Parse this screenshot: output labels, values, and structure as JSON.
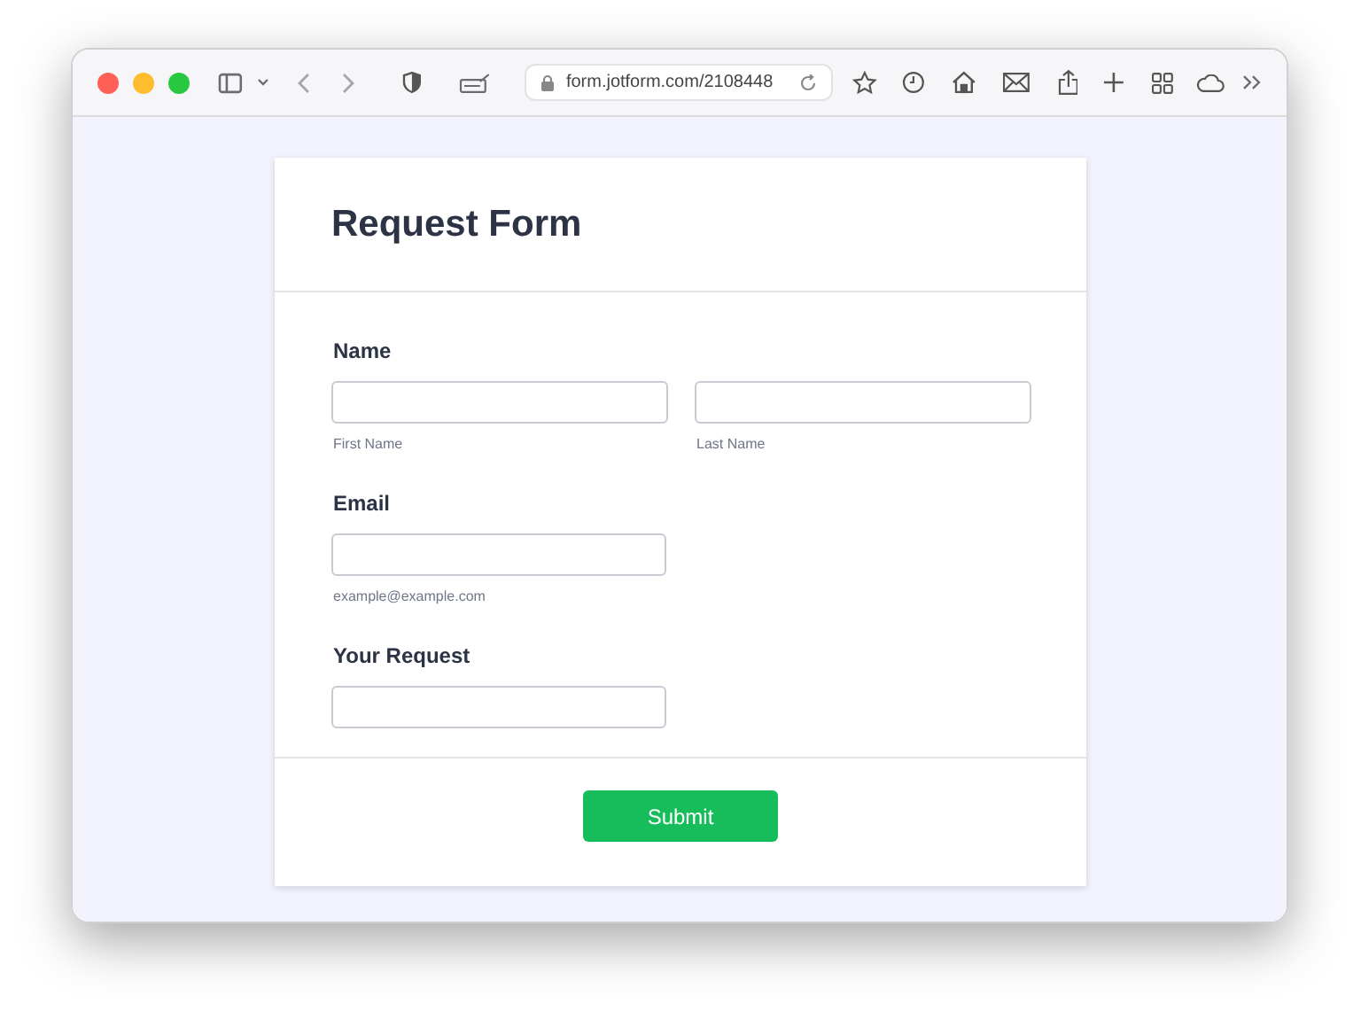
{
  "browser": {
    "url": "form.jotform.com/2108448"
  },
  "form": {
    "title": "Request Form",
    "fields": [
      {
        "label": "Name",
        "kind": "pair",
        "inputs": [
          {
            "kind": "text",
            "sublabel": "First Name"
          },
          {
            "kind": "text",
            "sublabel": "Last Name"
          }
        ]
      },
      {
        "label": "Email",
        "kind": "single",
        "inputs": [
          {
            "kind": "text",
            "sublabel": "example@example.com"
          }
        ]
      },
      {
        "label": "Your Request",
        "kind": "single",
        "inputs": [
          {
            "kind": "text"
          }
        ]
      }
    ],
    "submit": "Submit"
  }
}
